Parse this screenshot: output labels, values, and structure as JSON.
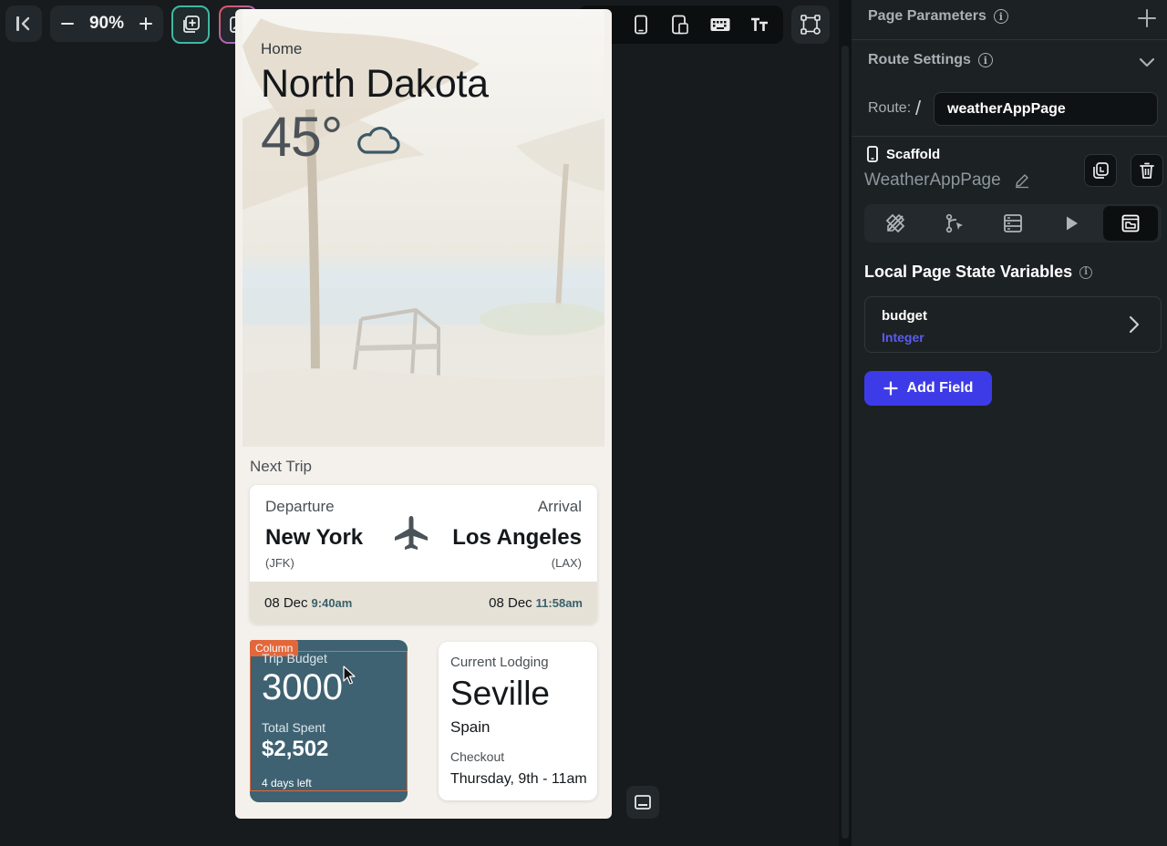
{
  "toolbar": {
    "zoom_value": "90%",
    "icons": [
      "collapse-left-icon",
      "minus-icon",
      "plus-icon",
      "layers-icon",
      "magic-icon",
      "sun-icon",
      "phone-icon",
      "tablet-icon",
      "keyboard-icon",
      "text-size-icon",
      "widget-tree-icon",
      "bottom-panel-icon"
    ]
  },
  "phone": {
    "breadcrumb": "Home",
    "city": "North Dakota",
    "temperature": "45°",
    "weather_icon": "cloud-icon",
    "next_trip_label": "Next Trip",
    "trip": {
      "departure_label": "Departure",
      "departure_city": "New York",
      "departure_code": "(JFK)",
      "arrival_label": "Arrival",
      "arrival_city": "Los Angeles",
      "arrival_code": "(LAX)",
      "departure_date": "08 Dec",
      "departure_time": "9:40am",
      "arrival_date": "08 Dec",
      "arrival_time": "11:58am"
    },
    "budget": {
      "selection_tag": "Column",
      "label": "Trip Budget",
      "value": "3000",
      "spent_label": "Total Spent",
      "spent_value": "$2,502",
      "days_left": "4 days left"
    },
    "lodging": {
      "label": "Current Lodging",
      "city": "Seville",
      "country": "Spain",
      "checkout_label": "Checkout",
      "checkout_value": "Thursday, 9th - 11am"
    }
  },
  "panel": {
    "page_parameters_title": "Page Parameters",
    "route_settings_title": "Route Settings",
    "route_label": "Route:",
    "route_slash": "/",
    "route_value": "weatherAppPage",
    "scaffold_label": "Scaffold",
    "page_name": "WeatherAppPage",
    "local_state_title": "Local Page State Variables",
    "variables": [
      {
        "name": "budget",
        "type": "Integer"
      }
    ],
    "add_field_label": "Add Field"
  },
  "colors": {
    "accent_teal": "#3fb8a4",
    "accent_blue": "#3d3be8",
    "selection_orange": "#e2683c",
    "budget_card": "#3e6272"
  }
}
